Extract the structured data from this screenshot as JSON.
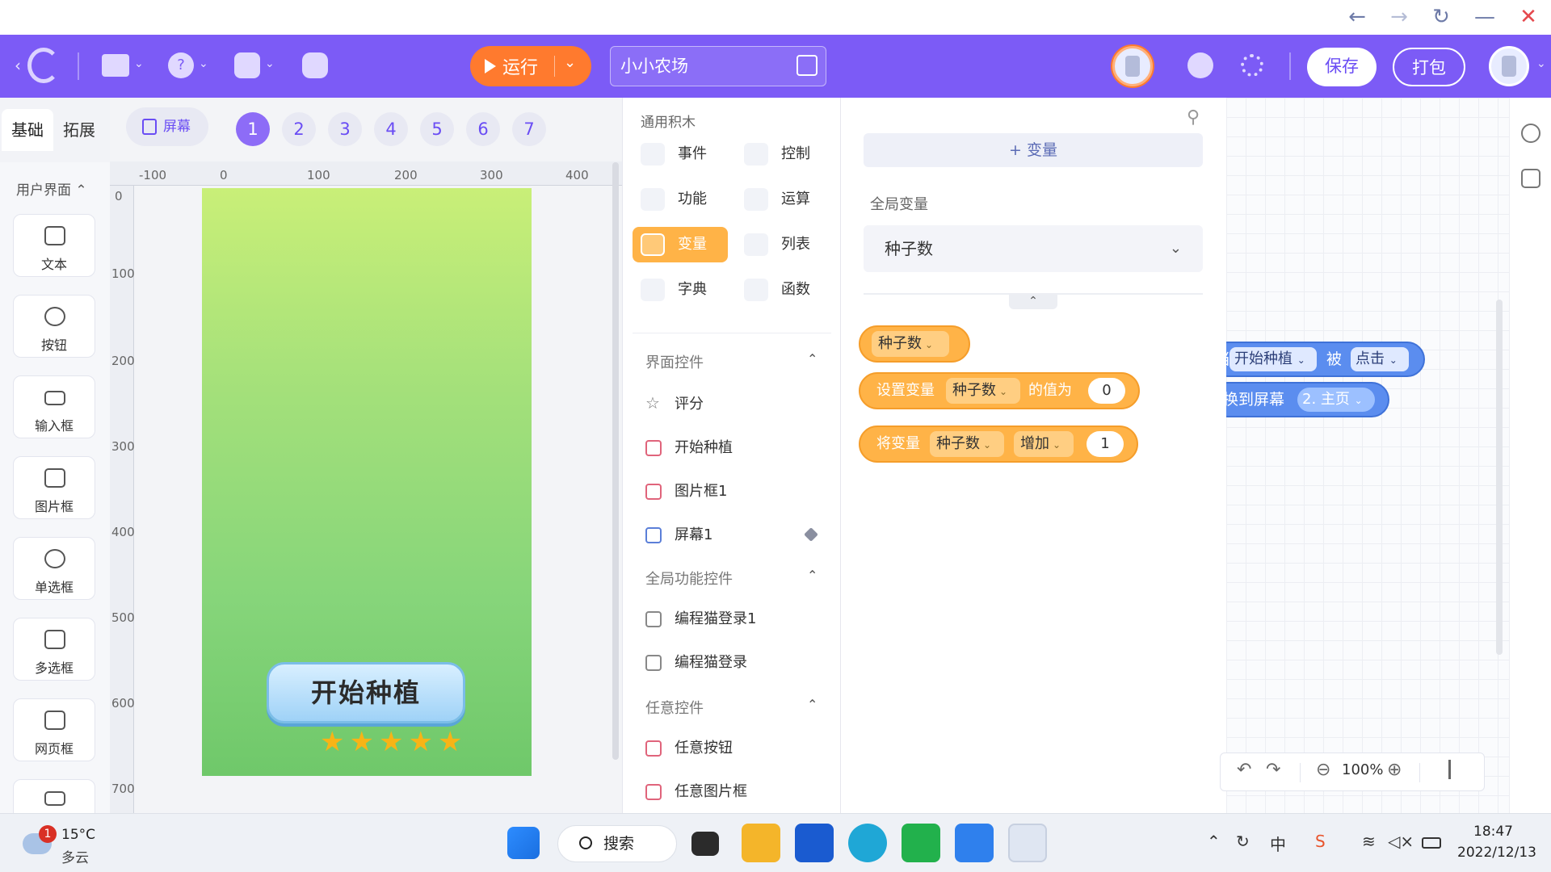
{
  "app": {
    "project_name": "小小农场"
  },
  "header": {
    "run_label": "运行",
    "save_label": "保存",
    "pack_label": "打包"
  },
  "left_tabs": [
    "基础",
    "拓展"
  ],
  "components": {
    "section_title": "用户界面",
    "items": [
      "文本",
      "按钮",
      "输入框",
      "图片框",
      "单选框",
      "多选框",
      "网页框"
    ]
  },
  "canvas": {
    "screen_button": "屏幕",
    "pages": [
      "1",
      "2",
      "3",
      "4",
      "5",
      "6",
      "7"
    ],
    "active_page": "1",
    "ruler_x": [
      "-100",
      "0",
      "100",
      "200",
      "300",
      "400"
    ],
    "ruler_y": [
      "0",
      "100",
      "200",
      "300",
      "400",
      "500",
      "600",
      "700"
    ],
    "start_button_text": "开始种植",
    "rating_stars": 5
  },
  "blocks": {
    "common_title": "通用积木",
    "categories": [
      "事件",
      "控制",
      "功能",
      "运算",
      "变量",
      "列表",
      "字典",
      "函数"
    ],
    "active_category": "变量",
    "ui_controls_title": "界面控件",
    "ui_controls": [
      "评分",
      "开始种植",
      "图片框1",
      "屏幕1"
    ],
    "global_controls_title": "全局功能控件",
    "global_controls": [
      "编程猫登录1",
      "编程猫登录"
    ],
    "any_controls_title": "任意控件",
    "any_controls": [
      "任意按钮",
      "任意图片框"
    ]
  },
  "variables": {
    "add_label": "+ 变量",
    "global_label": "全局变量",
    "selected": "种子数",
    "var_block": "种子数",
    "set_block": {
      "prefix": "设置变量",
      "var": "种子数",
      "mid": "的值为",
      "value": "0"
    },
    "change_block": {
      "prefix": "将变量",
      "var": "种子数",
      "op": "增加",
      "value": "1"
    }
  },
  "workspace": {
    "event_block": {
      "when": "当",
      "target": "开始种植",
      "was": "被",
      "action": "点击"
    },
    "switch_block": {
      "label": "换到屏幕",
      "screen": "2. 主页"
    },
    "zoom": "100%"
  },
  "taskbar": {
    "weather_temp": "15°C",
    "weather_desc": "多云",
    "weather_badge": "1",
    "search_label": "搜索",
    "ime": "中",
    "time": "18:47",
    "date": "2022/12/13"
  },
  "colors": {
    "header": "#7c5bf6",
    "run": "#ff7a2e",
    "variable_block": "#ffb347",
    "event_block": "#5b8def"
  }
}
